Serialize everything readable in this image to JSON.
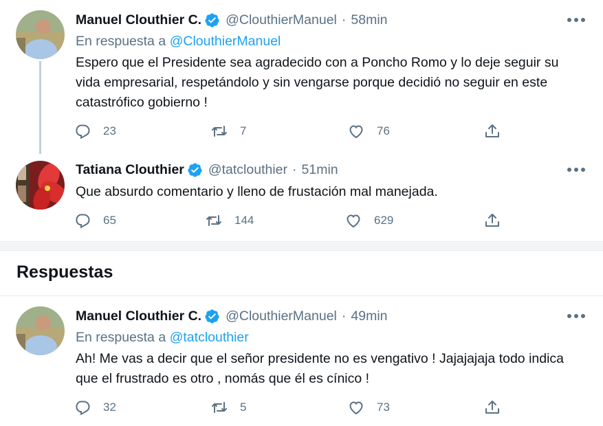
{
  "tweets": [
    {
      "name": "Manuel Clouthier C.",
      "handle": "@ClouthierManuel",
      "separator": "·",
      "time": "58min",
      "reply_prefix": "En respuesta a",
      "reply_handle": "@ClouthierManuel",
      "text": "Espero que el Presidente sea agradecido con a Poncho Romo y lo deje seguir su vida empresarial, respetándolo y sin vengarse porque decidió no seguir en este catastrófico gobierno !",
      "replies": "23",
      "retweets": "7",
      "likes": "76"
    },
    {
      "name": "Tatiana Clouthier",
      "handle": "@tatclouthier",
      "separator": "·",
      "time": "51min",
      "text": "Que absurdo comentario y lleno de frustación mal manejada.",
      "replies": "65",
      "retweets": "144",
      "likes": "629"
    },
    {
      "name": "Manuel Clouthier C.",
      "handle": "@ClouthierManuel",
      "separator": "·",
      "time": "49min",
      "reply_prefix": "En respuesta a",
      "reply_handle": "@tatclouthier",
      "text": "Ah! Me vas a decir que el señor presidente no es vengativo ! Jajajajaja todo indica que el frustrado es otro , nomás que él es cínico !",
      "replies": "32",
      "retweets": "5",
      "likes": "73"
    }
  ],
  "section": {
    "title": "Respuestas"
  },
  "colors": {
    "text": "#0f1419",
    "secondary": "#5b7083",
    "link": "#1da1f2",
    "verified": "#1da1f2",
    "divider": "#e6ecf0"
  },
  "icons": {
    "verified": "verified-badge-icon",
    "reply": "reply-icon",
    "retweet": "retweet-icon",
    "like": "heart-icon",
    "share": "share-icon",
    "more": "more-options-icon"
  }
}
